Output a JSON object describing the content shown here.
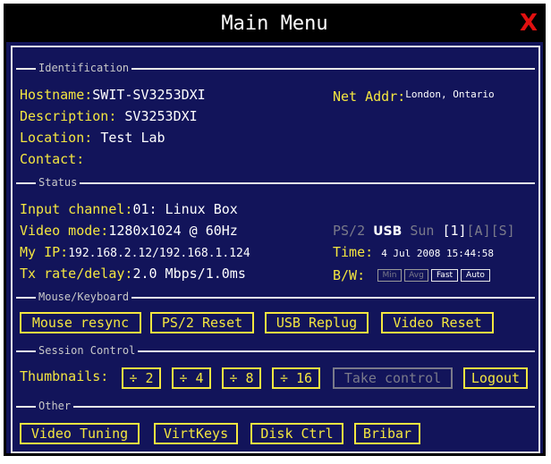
{
  "window": {
    "title": "Main Menu",
    "close_glyph": "X",
    "close_color": "#e01010",
    "background": "#12145a"
  },
  "sections": {
    "identification": "Identification",
    "status": "Status",
    "mouse_keyboard": "Mouse/Keyboard",
    "session_control": "Session Control",
    "other": "Other"
  },
  "identification": {
    "hostname_label": "Hostname:",
    "hostname": "SWIT-SV3253DXI",
    "description_label": "Description:",
    "description": "SV3253DXI",
    "location_label": "Location:",
    "location": "Test Lab",
    "contact_label": "Contact:",
    "contact": "",
    "net_addr_label": "Net Addr:",
    "net_addr": "London, Ontario"
  },
  "status": {
    "input_channel_label": "Input channel:",
    "input_channel": "01: Linux Box",
    "video_mode_label": "Video mode:",
    "video_mode": "1280x1024 @ 60Hz",
    "my_ip_label": "My IP:",
    "my_ip": "192.168.2.12/192.168.1.124",
    "tx_label": "Tx rate/delay:",
    "tx": "2.0 Mbps/1.0ms",
    "kbd_ps2": "PS/2",
    "kbd_usb": "USB",
    "kbd_sun": "Sun",
    "kbd_1": "[1]",
    "kbd_a": "[A]",
    "kbd_s": "[S]",
    "time_label": "Time:",
    "time": "4 Jul 2008 15:44:58",
    "bw_label": "B/W:",
    "bw_options": [
      "Min",
      "Avg",
      "Fast",
      "Auto"
    ]
  },
  "mouse_keyboard": {
    "mouse_resync": "Mouse resync",
    "ps2_reset": "PS/2 Reset",
    "usb_replug": "USB Replug",
    "video_reset": "Video Reset"
  },
  "session_control": {
    "thumbnails_label": "Thumbnails:",
    "div2": "÷ 2",
    "div4": "÷ 4",
    "div8": "÷ 8",
    "div16": "÷ 16",
    "take_control": "Take control",
    "logout": "Logout"
  },
  "other": {
    "video_tuning": "Video Tuning",
    "virtkeys": "VirtKeys",
    "disk_ctrl": "Disk Ctrl",
    "bribar": "Bribar"
  },
  "colors": {
    "accent": "#f4e640",
    "disabled": "#7a7a8a",
    "text": "#ffffff"
  }
}
